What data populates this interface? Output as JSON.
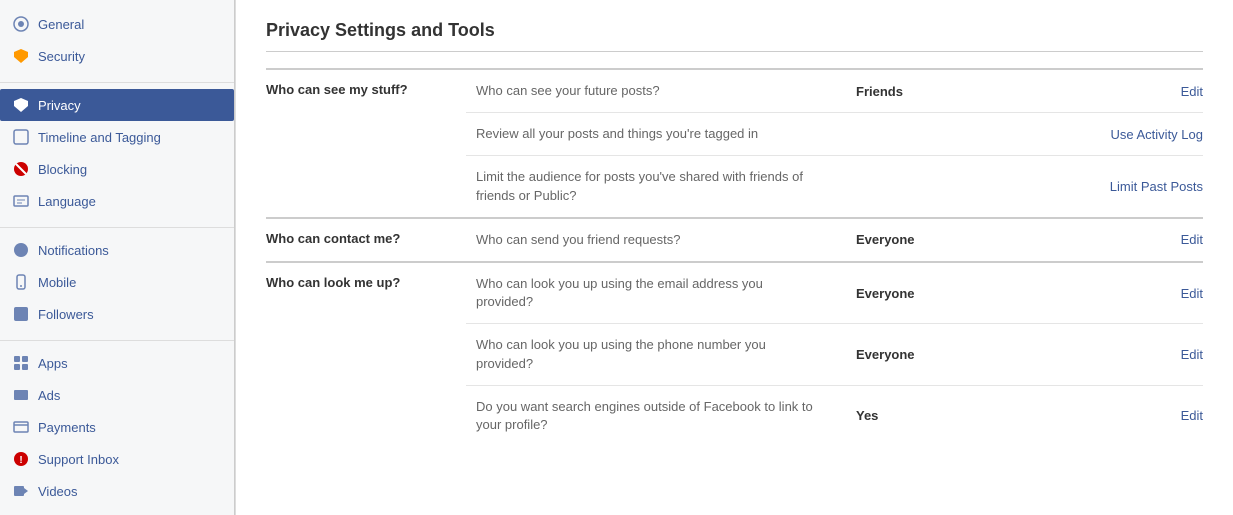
{
  "sidebar": {
    "items": [
      {
        "id": "general",
        "label": "General",
        "icon": "gear-icon",
        "active": false
      },
      {
        "id": "security",
        "label": "Security",
        "icon": "shield-icon",
        "active": false
      },
      {
        "id": "privacy",
        "label": "Privacy",
        "icon": "lock-icon",
        "active": true
      },
      {
        "id": "timeline",
        "label": "Timeline and Tagging",
        "icon": "timeline-icon",
        "active": false
      },
      {
        "id": "blocking",
        "label": "Blocking",
        "icon": "block-icon",
        "active": false
      },
      {
        "id": "language",
        "label": "Language",
        "icon": "language-icon",
        "active": false
      },
      {
        "id": "notifications",
        "label": "Notifications",
        "icon": "notification-icon",
        "active": false
      },
      {
        "id": "mobile",
        "label": "Mobile",
        "icon": "mobile-icon",
        "active": false
      },
      {
        "id": "followers",
        "label": "Followers",
        "icon": "followers-icon",
        "active": false
      },
      {
        "id": "apps",
        "label": "Apps",
        "icon": "apps-icon",
        "active": false
      },
      {
        "id": "ads",
        "label": "Ads",
        "icon": "ads-icon",
        "active": false
      },
      {
        "id": "payments",
        "label": "Payments",
        "icon": "payments-icon",
        "active": false
      },
      {
        "id": "support",
        "label": "Support Inbox",
        "icon": "support-icon",
        "active": false
      },
      {
        "id": "videos",
        "label": "Videos",
        "icon": "videos-icon",
        "active": false
      }
    ]
  },
  "main": {
    "title": "Privacy Settings and Tools",
    "sections": [
      {
        "id": "see-stuff",
        "header": "Who can see my stuff?",
        "rows": [
          {
            "description": "Who can see your future posts?",
            "value": "Friends",
            "action": "Edit",
            "action_type": "edit"
          },
          {
            "description": "Review all your posts and things you're tagged in",
            "value": "",
            "action": "Use Activity Log",
            "action_type": "link"
          },
          {
            "description": "Limit the audience for posts you've shared with friends of friends or Public?",
            "value": "",
            "action": "Limit Past Posts",
            "action_type": "link"
          }
        ]
      },
      {
        "id": "contact-me",
        "header": "Who can contact me?",
        "rows": [
          {
            "description": "Who can send you friend requests?",
            "value": "Everyone",
            "action": "Edit",
            "action_type": "edit"
          }
        ]
      },
      {
        "id": "look-me-up",
        "header": "Who can look me up?",
        "rows": [
          {
            "description": "Who can look you up using the email address you provided?",
            "value": "Everyone",
            "action": "Edit",
            "action_type": "edit"
          },
          {
            "description": "Who can look you up using the phone number you provided?",
            "value": "Everyone",
            "action": "Edit",
            "action_type": "edit"
          },
          {
            "description": "Do you want search engines outside of Facebook to link to your profile?",
            "value": "Yes",
            "action": "Edit",
            "action_type": "edit"
          }
        ]
      }
    ]
  }
}
